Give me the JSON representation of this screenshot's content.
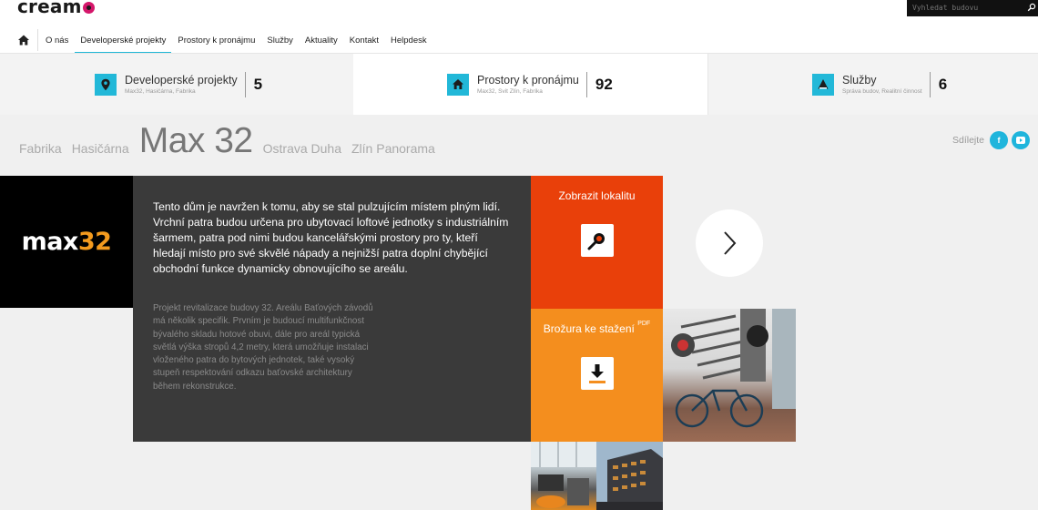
{
  "brand": {
    "name": "cream"
  },
  "search": {
    "placeholder": "Vyhledat budovu"
  },
  "nav": {
    "items": [
      "O nás",
      "Developerské projekty",
      "Prostory k pronájmu",
      "Služby",
      "Aktuality",
      "Kontakt",
      "Helpdesk"
    ],
    "active_index": 1
  },
  "stats": [
    {
      "title": "Developerské projekty",
      "sub": "Max32, Hasičárna, Fabrika",
      "count": "5",
      "icon": "location-pin-icon"
    },
    {
      "title": "Prostory k pronájmu",
      "sub": "Max32, Svit Zlín, Fabrika",
      "count": "92",
      "icon": "house-icon"
    },
    {
      "title": "Služby",
      "sub": "Správa budov, Realitní činnost",
      "count": "6",
      "icon": "person-icon"
    }
  ],
  "projects": {
    "tabs": [
      "Fabrika",
      "Hasičárna",
      "Max 32",
      "Ostrava Duha",
      "Zlín Panorama"
    ],
    "active_index": 2
  },
  "share": {
    "label": "Sdílejte",
    "buttons": [
      "f",
      "yt"
    ]
  },
  "project": {
    "logo_word": "max",
    "logo_number": "32",
    "lead": "Tento dům je navržen k tomu, aby se stal pulzujícím místem plným lidí. Vrchní patra budou určena pro ubytovací loftové jednotky s industriálním šarmem, patra pod nimi budou kancelářskými prostory pro ty, kteří hledají místo pro své skvělé nápady a nejnižší patra doplní chybějící obchodní funkce dynamicky obnovujícího se areálu.",
    "body": "Projekt revitalizace budovy 32. Areálu Baťových závodů má několik specifik. Prvním je budoucí multifunkčnost bývalého skladu hotové obuvi, dále pro areál typická světlá výška stropů 4,2 metry, která umožňuje instalaci vloženého patra do bytových jednotek, také vysoký stupeň respektování odkazu baťovské architektury během rekonstrukce.",
    "location_label": "Zobrazit lokalitu",
    "brochure_label": "Brožura ke stažení",
    "brochure_sup": "PDF"
  },
  "colors": {
    "accent": "#20b7d6",
    "location_tile": "#e9400a",
    "brochure_tile": "#f48e1e",
    "dark_tile": "#3a3a3a"
  }
}
